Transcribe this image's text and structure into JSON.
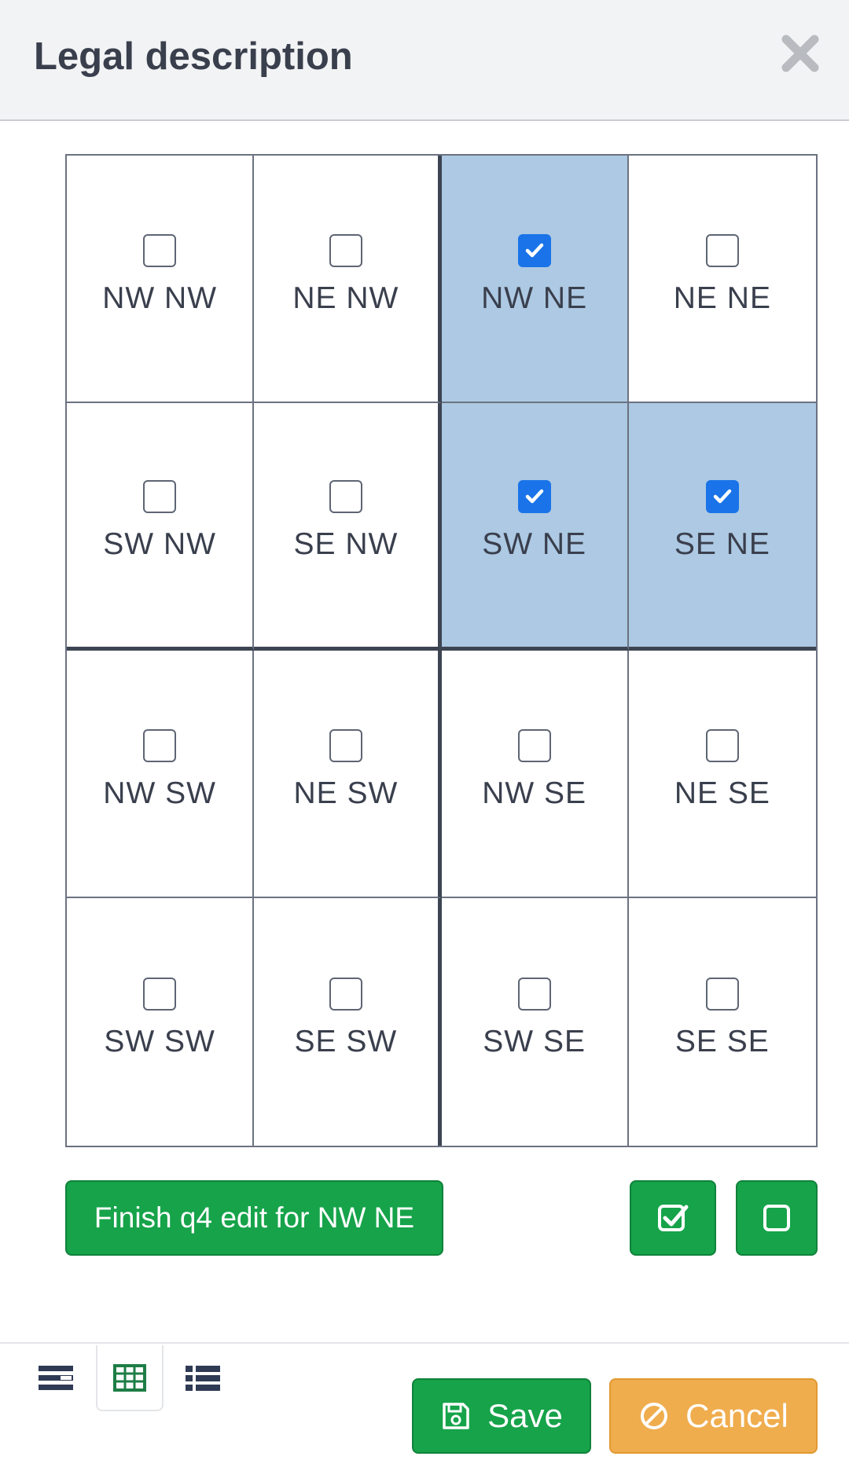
{
  "dialog": {
    "title": "Legal description",
    "close_icon": "close-icon"
  },
  "grid": {
    "cells": [
      {
        "label": "NW NW",
        "checked": false
      },
      {
        "label": "NE NW",
        "checked": false
      },
      {
        "label": "NW NE",
        "checked": true
      },
      {
        "label": "NE NE",
        "checked": false
      },
      {
        "label": "SW NW",
        "checked": false
      },
      {
        "label": "SE NW",
        "checked": false
      },
      {
        "label": "SW NE",
        "checked": true
      },
      {
        "label": "SE NE",
        "checked": true
      },
      {
        "label": "NW SW",
        "checked": false
      },
      {
        "label": "NE SW",
        "checked": false
      },
      {
        "label": "NW SE",
        "checked": false
      },
      {
        "label": "NE SE",
        "checked": false
      },
      {
        "label": "SW SW",
        "checked": false
      },
      {
        "label": "SE SW",
        "checked": false
      },
      {
        "label": "SW SE",
        "checked": false
      },
      {
        "label": "SE SE",
        "checked": false
      }
    ]
  },
  "actions": {
    "finish_label": "Finish q4 edit for NW NE",
    "check_all_icon": "check-square-icon",
    "uncheck_all_icon": "square-icon"
  },
  "footer": {
    "tabs": [
      {
        "icon": "rows-icon",
        "active": false
      },
      {
        "icon": "table-grid-icon",
        "active": true
      },
      {
        "icon": "list-icon",
        "active": false
      }
    ],
    "save_label": "Save",
    "cancel_label": "Cancel"
  },
  "colors": {
    "selected_cell": "#adc9e3",
    "checkbox_checked": "#1a73e8",
    "primary_green": "#16a34a",
    "cancel_orange": "#f0ad4e",
    "active_tab_icon": "#1e7d45"
  }
}
